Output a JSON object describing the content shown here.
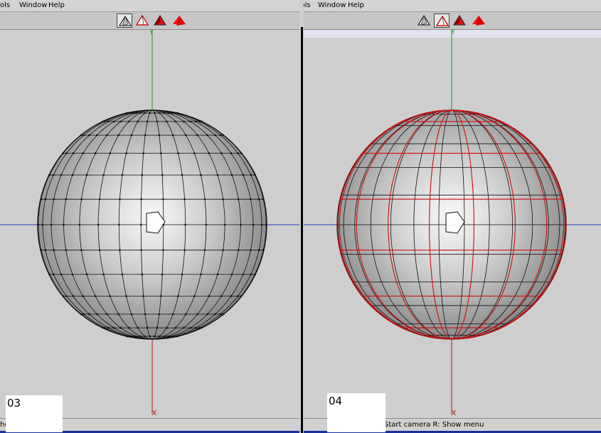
{
  "left_view": {
    "menu": [
      "ols",
      "Window",
      "Help"
    ],
    "status_text": "ho",
    "label": "03",
    "axis_labels": {
      "y": "Y",
      "x": "X"
    },
    "selected_tool": 0
  },
  "right_view": {
    "menu": [
      "Tools",
      "Window",
      "Help"
    ],
    "status_text": "Start camera   R: Show menu",
    "label": "04",
    "axis_labels": {
      "y": "Y",
      "x": "X"
    },
    "selected_tool": 1
  },
  "toolbar_icons": [
    "wireframe-tetra-icon",
    "outline-tetra-icon",
    "shaded-tetra-icon",
    "solid-red-tetra-icon"
  ],
  "colors": {
    "y_axis": "#1a9b1a",
    "x_axis": "#b51414",
    "z_axis": "#2a3fc8",
    "mesh_edge": "#111111",
    "dual_edge": "#cc1010",
    "status_accent": "#1a2f9c"
  }
}
